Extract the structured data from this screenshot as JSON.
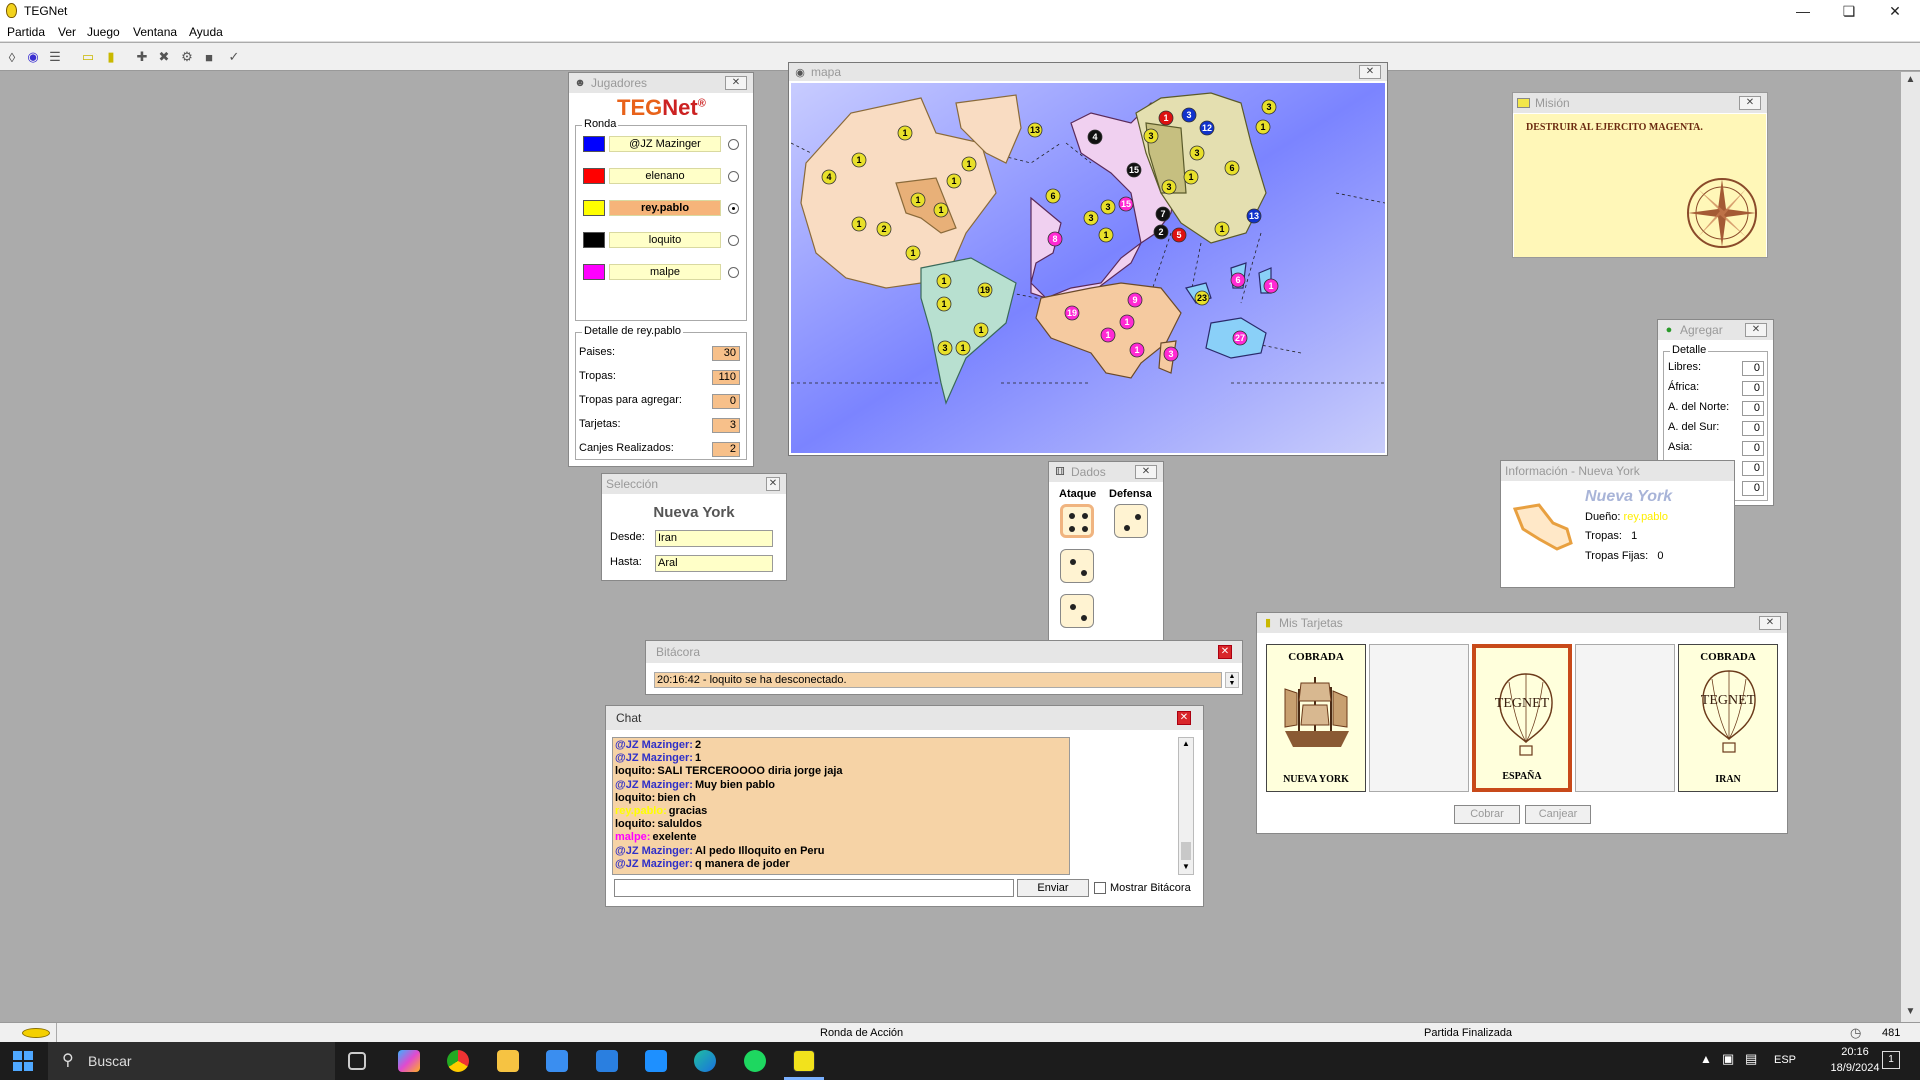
{
  "app": {
    "title": "TEGNet"
  },
  "menu": [
    "Partida",
    "Ver",
    "Juego",
    "Ventana",
    "Ayuda"
  ],
  "players_window": {
    "title": "Jugadores",
    "logo_a": "TEG",
    "logo_b": "Net",
    "logo_mark": "®",
    "round_label": "Ronda",
    "players": [
      {
        "name": "@JZ Mazinger",
        "color": "#0000ff",
        "active": false
      },
      {
        "name": "elenano",
        "color": "#ff0000",
        "active": false
      },
      {
        "name": "rey.pablo",
        "color": "#ffff00",
        "active": true
      },
      {
        "name": "loquito",
        "color": "#000000",
        "active": false
      },
      {
        "name": "malpe",
        "color": "#ff00ff",
        "active": false
      }
    ],
    "detail_label": "Detalle de rey.pablo",
    "detail": [
      {
        "label": "Paises:",
        "value": "30"
      },
      {
        "label": "Tropas:",
        "value": "110"
      },
      {
        "label": "Tropas para agregar:",
        "value": "0"
      },
      {
        "label": "Tarjetas:",
        "value": "3"
      },
      {
        "label": "Canjes Realizados:",
        "value": "2"
      }
    ]
  },
  "map_window": {
    "title": "mapa"
  },
  "map_markers": [
    {
      "v": "13",
      "c": "#e8e02a"
    },
    {
      "v": "1",
      "c": "#e8e02a"
    },
    {
      "v": "1",
      "c": "#e8e02a"
    },
    {
      "v": "4",
      "c": "#e8e02a"
    },
    {
      "v": "1",
      "c": "#e8e02a"
    },
    {
      "v": "1",
      "c": "#e8e02a"
    },
    {
      "v": "1",
      "c": "#e8e02a"
    },
    {
      "v": "1",
      "c": "#e8e02a"
    },
    {
      "v": "1",
      "c": "#e8e02a"
    },
    {
      "v": "2",
      "c": "#e8e02a"
    },
    {
      "v": "1",
      "c": "#e8e02a"
    },
    {
      "v": "1",
      "c": "#e8e02a"
    },
    {
      "v": "19",
      "c": "#e8e02a"
    },
    {
      "v": "1",
      "c": "#e8e02a"
    },
    {
      "v": "1",
      "c": "#e8e02a"
    },
    {
      "v": "3",
      "c": "#e8e02a"
    },
    {
      "v": "1",
      "c": "#e8e02a"
    },
    {
      "v": "6",
      "c": "#e8e02a"
    },
    {
      "v": "8",
      "c": "#ff2ad4"
    },
    {
      "v": "3",
      "c": "#e8e02a"
    },
    {
      "v": "3",
      "c": "#e8e02a"
    },
    {
      "v": "1",
      "c": "#e8e02a"
    },
    {
      "v": "15",
      "c": "#ff2ad4"
    },
    {
      "v": "4",
      "c": "#111111"
    },
    {
      "v": "15",
      "c": "#111111"
    },
    {
      "v": "7",
      "c": "#111111"
    },
    {
      "v": "2",
      "c": "#111111"
    },
    {
      "v": "5",
      "c": "#dd1111"
    },
    {
      "v": "1",
      "c": "#dd1111"
    },
    {
      "v": "3",
      "c": "#1133cc"
    },
    {
      "v": "12",
      "c": "#1133cc"
    },
    {
      "v": "3",
      "c": "#e8e02a"
    },
    {
      "v": "3",
      "c": "#e8e02a"
    },
    {
      "v": "3",
      "c": "#e8e02a"
    },
    {
      "v": "3",
      "c": "#e8e02a"
    },
    {
      "v": "1",
      "c": "#e8e02a"
    },
    {
      "v": "6",
      "c": "#e8e02a"
    },
    {
      "v": "1",
      "c": "#e8e02a"
    },
    {
      "v": "13",
      "c": "#1133cc"
    },
    {
      "v": "1",
      "c": "#e8e02a"
    },
    {
      "v": "19",
      "c": "#ff2ad4"
    },
    {
      "v": "9",
      "c": "#ff2ad4"
    },
    {
      "v": "1",
      "c": "#ff2ad4"
    },
    {
      "v": "1",
      "c": "#ff2ad4"
    },
    {
      "v": "1",
      "c": "#ff2ad4"
    },
    {
      "v": "3",
      "c": "#ff2ad4"
    },
    {
      "v": "23",
      "c": "#e8e02a"
    },
    {
      "v": "6",
      "c": "#ff2ad4"
    },
    {
      "v": "1",
      "c": "#ff2ad4"
    },
    {
      "v": "27",
      "c": "#ff2ad4"
    }
  ],
  "mission_window": {
    "title": "Misión",
    "text": "DESTRUIR AL EJERCITO MAGENTA."
  },
  "add_window": {
    "title": "Agregar",
    "detail_label": "Detalle",
    "rows": [
      {
        "label": "Libres:",
        "value": "0"
      },
      {
        "label": "África:",
        "value": "0"
      },
      {
        "label": "A. del Norte:",
        "value": "0"
      },
      {
        "label": "A. del Sur:",
        "value": "0"
      },
      {
        "label": "Asia:",
        "value": "0"
      },
      {
        "label": "Europa:",
        "value": "0"
      },
      {
        "label": "Oceanía:",
        "value": "0"
      }
    ]
  },
  "info_window": {
    "title": "Información - Nueva York",
    "country": "Nueva York",
    "owner_label": "Dueño:",
    "owner": "rey.pablo",
    "troops_label": "Tropas:",
    "troops": "1",
    "fixed_label": "Tropas Fijas:",
    "fixed": "0"
  },
  "selection_window": {
    "title": "Selección",
    "country": "Nueva York",
    "from_label": "Desde:",
    "from": "Iran",
    "to_label": "Hasta:",
    "to": "Aral"
  },
  "dice_window": {
    "title": "Dados",
    "attack_label": "Ataque",
    "defense_label": "Defensa"
  },
  "log_window": {
    "title": "Bitácora",
    "line": "20:16:42 - loquito se ha desconectado."
  },
  "cards_window": {
    "title": "Mis Tarjetas",
    "cards": [
      {
        "state": "COBRADA",
        "name": "NUEVA YORK"
      },
      {
        "state": "",
        "name": ""
      },
      {
        "state": "TEGNET",
        "name": "ESPAÑA"
      },
      {
        "state": "",
        "name": ""
      },
      {
        "state": "COBRADA",
        "name": "IRAN"
      }
    ],
    "card_brand": "TEGNET",
    "cobrar_label": "Cobrar",
    "canjear_label": "Canjear"
  },
  "chat_window": {
    "title": "Chat",
    "messages": [
      {
        "who": "@JZ Mazinger:",
        "text": "2",
        "color": "#3030c8"
      },
      {
        "who": "@JZ Mazinger:",
        "text": "1",
        "color": "#3030c8"
      },
      {
        "who": "loquito:",
        "text": "SALI TERCEROOOO diria jorge jaja",
        "color": "#000000"
      },
      {
        "who": "@JZ Mazinger:",
        "text": "Muy bien pablo",
        "color": "#3030c8"
      },
      {
        "who": "loquito:",
        "text": "bien ch",
        "color": "#000000"
      },
      {
        "who": "rey.pablo:",
        "text": "gracias",
        "color": "#ffff00"
      },
      {
        "who": "loquito:",
        "text": "saluldos",
        "color": "#000000"
      },
      {
        "who": "malpe:",
        "text": "exelente",
        "color": "#ff00ff"
      },
      {
        "who": "@JZ Mazinger:",
        "text": "Al pedo Illoquito en Peru",
        "color": "#3030c8"
      },
      {
        "who": "@JZ Mazinger:",
        "text": "q manera de joder",
        "color": "#3030c8"
      }
    ],
    "input_value": "",
    "send_label": "Enviar",
    "show_log_label": "Mostrar Bitácora"
  },
  "statusbar": {
    "phase": "Ronda de Acción",
    "game_state": "Partida Finalizada",
    "count": "481"
  },
  "taskbar": {
    "search_placeholder": "Buscar",
    "lang": "ESP",
    "time": "20:16",
    "date": "18/9/2024",
    "notif": "1"
  }
}
